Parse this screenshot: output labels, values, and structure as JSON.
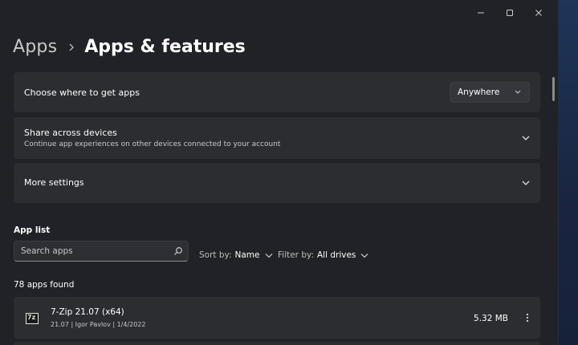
{
  "window": {
    "controls": [
      "minimize",
      "maximize",
      "close"
    ]
  },
  "breadcrumb": {
    "parent": "Apps",
    "current": "Apps & features"
  },
  "settings": {
    "choose_where": {
      "label": "Choose where to get apps",
      "dropdown_value": "Anywhere"
    },
    "share_across": {
      "label": "Share across devices",
      "description": "Continue app experiences on other devices connected to your account"
    },
    "more_settings": {
      "label": "More settings"
    }
  },
  "app_list": {
    "title": "App list",
    "search_placeholder": "Search apps",
    "sort_label": "Sort by:",
    "sort_value": "Name",
    "filter_label": "Filter by:",
    "filter_value": "All drives",
    "count_text": "78 apps found",
    "apps": [
      {
        "name": "7-Zip 21.07 (x64)",
        "meta": "21.07   |   Igor Pavlov   |   1/4/2022",
        "size": "5.32 MB",
        "icon": "7zip-icon"
      }
    ]
  },
  "colors": {
    "window_bg": "#202227",
    "card_bg": "#2b2d31",
    "desktop_bg": "#1b2640"
  }
}
